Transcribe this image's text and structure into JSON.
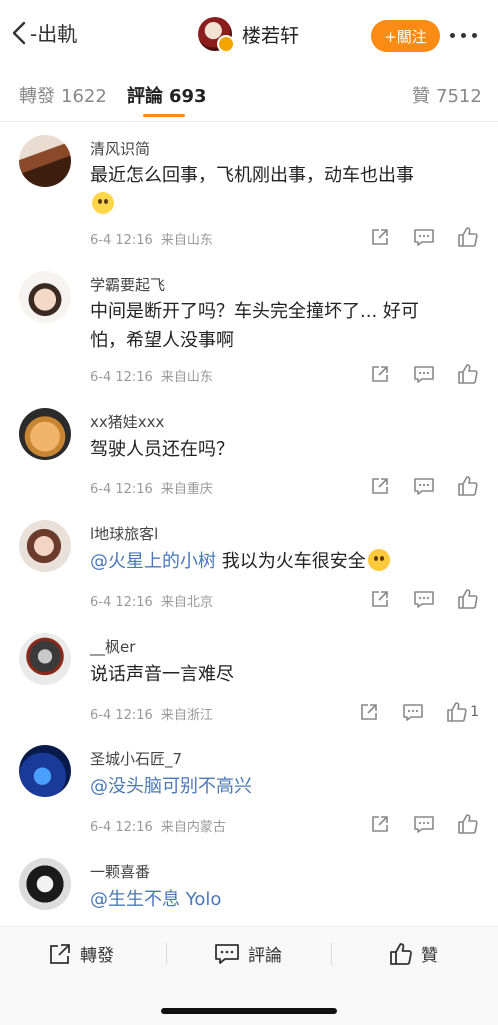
{
  "header": {
    "back_label": "-出軌",
    "account_name": "楼若轩",
    "follow_label": "+關注"
  },
  "tabs": [
    {
      "label": "轉發",
      "count": "1622"
    },
    {
      "label": "評論",
      "count": "693"
    },
    {
      "label": "贊",
      "count": "7512"
    }
  ],
  "comments": [
    {
      "name": "清风识简",
      "text_line1": "最近怎么回事，飞机刚出事，动车也出事",
      "time": "6-4 12:16",
      "source": "来自山东",
      "likes": ""
    },
    {
      "name": "学霸要起飞",
      "text_line1": "中间是断开了吗？车头完全撞坏了... 好可",
      "text_line2": "怕，希望人没事啊",
      "time": "6-4 12:16",
      "source": "来自山东",
      "likes": ""
    },
    {
      "name": "xx猪娃xxx",
      "text_line1": "驾驶人员还在吗？",
      "time": "6-4 12:16",
      "source": "来自重庆",
      "likes": ""
    },
    {
      "name": "l地球旅客l",
      "mention": "@火星上的小树",
      "text_line1": " 我以为火车很安全",
      "time": "6-4 12:16",
      "source": "来自北京",
      "likes": ""
    },
    {
      "name": "__枫er",
      "text_line1": "说话声音一言难尽",
      "time": "6-4 12:16",
      "source": "来自浙江",
      "likes": "1"
    },
    {
      "name": "圣城小石匠_7",
      "mention": "@没头脑可别不高兴",
      "time": "6-4 12:16",
      "source": "来自内蒙古",
      "likes": ""
    },
    {
      "name": "一颗喜番",
      "mention": "@生生不息 Yolo"
    }
  ],
  "bottom_bar": {
    "repost_label": "轉發",
    "comment_label": "評論",
    "like_label": "贊"
  },
  "colors": {
    "accent": "#fa8c16",
    "mention": "#4a78b8",
    "meta": "#999999"
  },
  "icons": [
    "chevron-left-icon",
    "more-dots-icon",
    "share-icon",
    "comment-icon",
    "thumbs-up-icon"
  ]
}
